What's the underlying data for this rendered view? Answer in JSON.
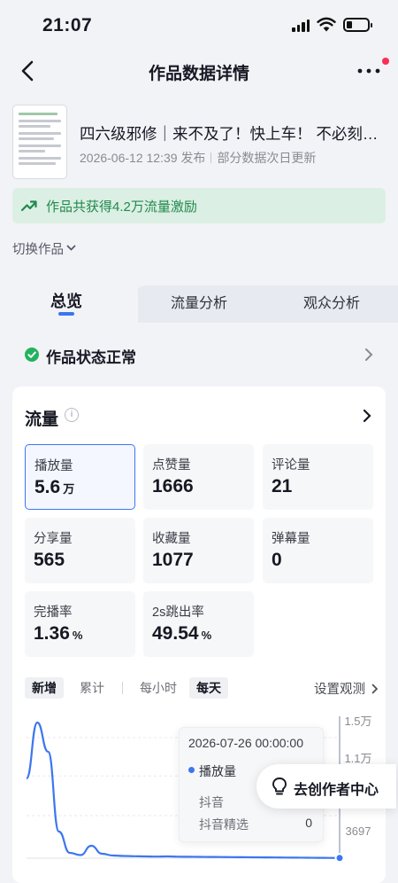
{
  "status_bar": {
    "time": "21:07"
  },
  "nav": {
    "title": "作品数据详情"
  },
  "work": {
    "title": "四六级邪修｜来不及了！快上车！ 不必刻意…",
    "publish_time": "2026-06-12 12:39 发布",
    "update_note": "部分数据次日更新"
  },
  "incentive": {
    "text": "作品共获得4.2万流量激励"
  },
  "switch_work": {
    "label": "切换作品"
  },
  "tabs": [
    {
      "label": "总览",
      "active": true
    },
    {
      "label": "流量分析",
      "active": false
    },
    {
      "label": "观众分析",
      "active": false
    }
  ],
  "work_status": {
    "text": "作品状态正常"
  },
  "traffic": {
    "title": "流量",
    "metrics": [
      {
        "label": "播放量",
        "value": "5.6",
        "unit": "万"
      },
      {
        "label": "点赞量",
        "value": "1666",
        "unit": ""
      },
      {
        "label": "评论量",
        "value": "21",
        "unit": ""
      },
      {
        "label": "分享量",
        "value": "565",
        "unit": ""
      },
      {
        "label": "收藏量",
        "value": "1077",
        "unit": ""
      },
      {
        "label": "弹幕量",
        "value": "0",
        "unit": ""
      },
      {
        "label": "完播率",
        "value": "1.36",
        "unit": "%"
      },
      {
        "label": "2s跳出率",
        "value": "49.54",
        "unit": "%"
      }
    ],
    "filters": {
      "mode": [
        "新增",
        "累计"
      ],
      "granularity": [
        "每小时",
        "每天"
      ],
      "observe_label": "设置观测"
    }
  },
  "chart_data": {
    "type": "line",
    "y_ticks": [
      "1.5万",
      "1.1万",
      "3697"
    ],
    "series": [
      {
        "name": "播放量",
        "color": "#3c76f0",
        "values": [
          9000,
          15300,
          12000,
          3000,
          600,
          350,
          1400,
          500,
          300,
          250,
          220,
          200,
          180,
          200,
          170,
          160,
          150,
          140,
          130,
          120,
          110,
          100,
          90,
          80,
          70,
          60,
          50,
          40,
          30,
          20
        ]
      }
    ],
    "tooltip": {
      "time": "2026-07-26 00:00:00",
      "series": "播放量",
      "rows": [
        {
          "label": "抖音",
          "value": ""
        },
        {
          "label": "抖音精选",
          "value": "0"
        }
      ]
    }
  },
  "fab": {
    "label": "去创作者中心"
  },
  "colors": {
    "accent": "#3c76f0",
    "success": "#22b35e",
    "incentive_bg": "#dcefe4",
    "badge": "#fe2c55"
  }
}
